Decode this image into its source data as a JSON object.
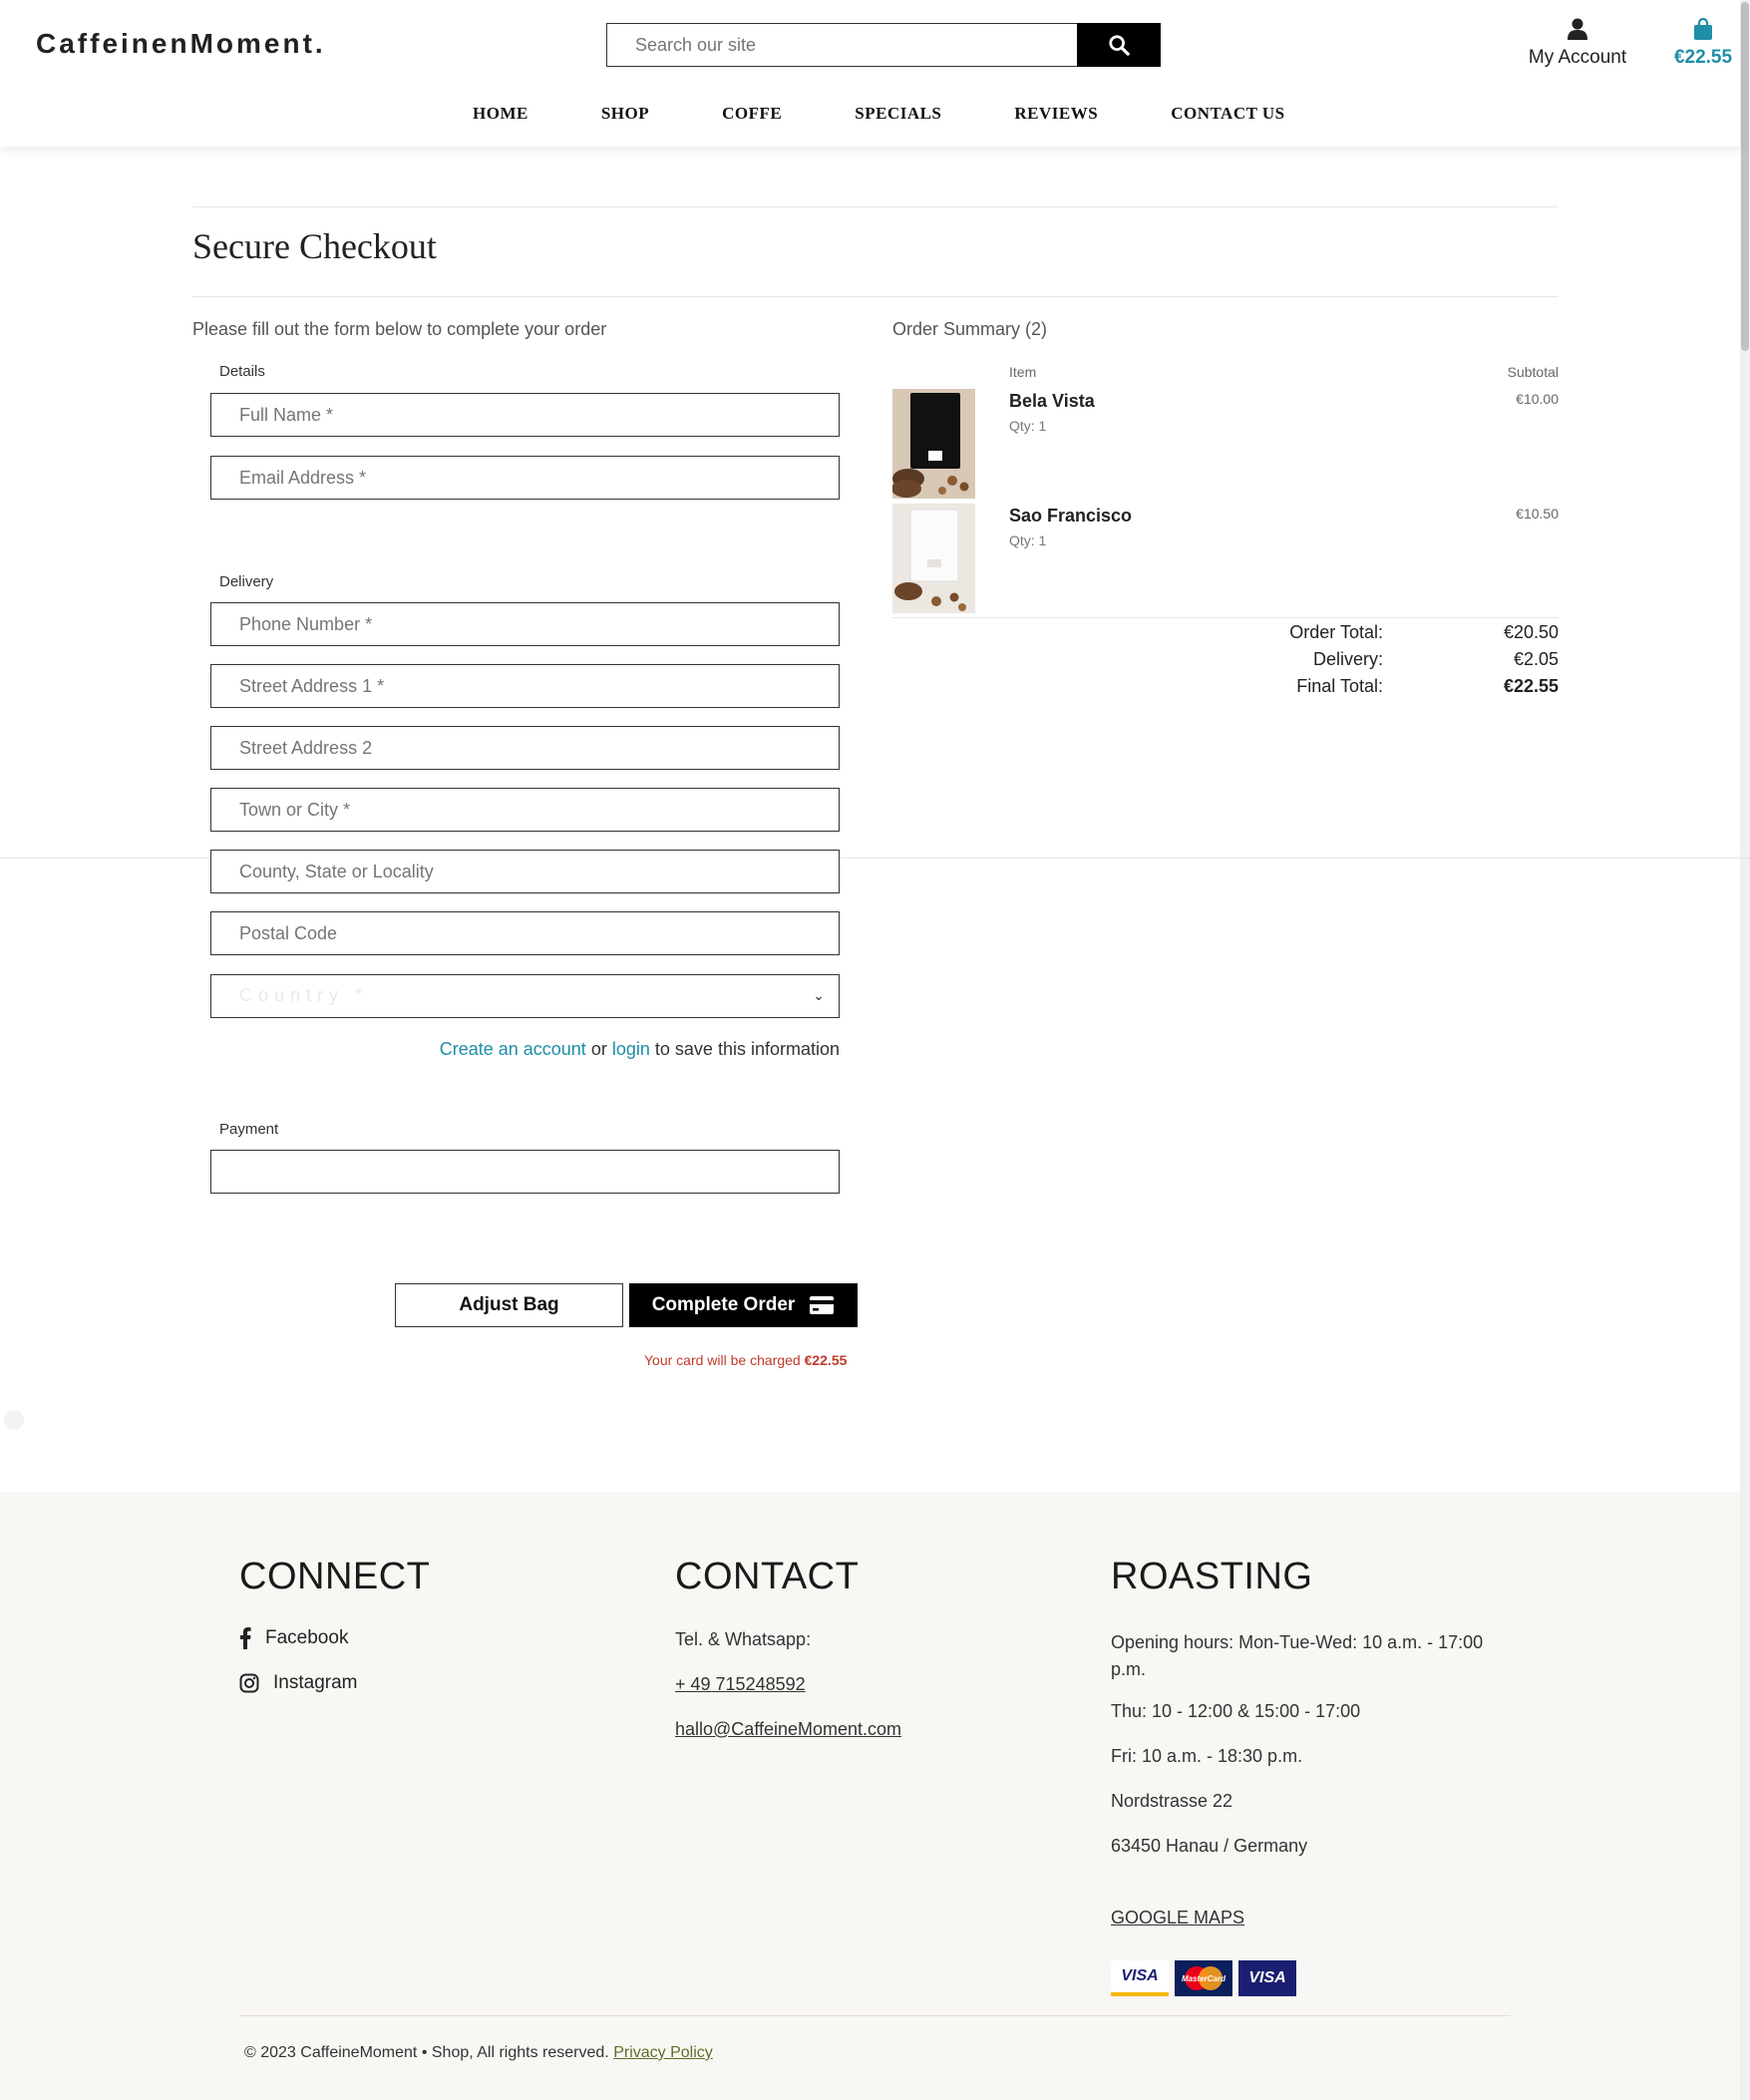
{
  "header": {
    "logo": "CaffeinenMoment.",
    "search_placeholder": "Search our site",
    "account_label": "My Account",
    "bag_total": "€22.55",
    "nav": [
      "HOME",
      "SHOP",
      "COFFE",
      "SPECIALS",
      "REVIEWS",
      "CONTACT US"
    ]
  },
  "checkout": {
    "title": "Secure Checkout",
    "intro": "Please fill out the form below to complete your order",
    "details_label": "Details",
    "full_name_placeholder": "Full Name *",
    "email_placeholder": "Email Address *",
    "delivery_label": "Delivery",
    "phone_placeholder": "Phone Number *",
    "street1_placeholder": "Street Address 1 *",
    "street2_placeholder": "Street Address 2",
    "town_placeholder": "Town or City *",
    "county_placeholder": "County, State or Locality",
    "postal_placeholder": "Postal Code",
    "country_selected": "Country *",
    "create_account": "Create an account",
    "or": "or",
    "login": "login",
    "save_suffix": "to save this information",
    "payment_label": "Payment",
    "adjust_bag": "Adjust Bag",
    "complete_order": "Complete Order",
    "charge_prefix": "Your card will be charged",
    "charge_amount": "€22.55"
  },
  "summary": {
    "title": "Order Summary (2)",
    "item_header": "Item",
    "subtotal_header": "Subtotal",
    "items": [
      {
        "name": "Bela Vista",
        "qty": "Qty: 1",
        "subtotal": "€10.00"
      },
      {
        "name": "Sao Francisco",
        "qty": "Qty: 1",
        "subtotal": "€10.50"
      }
    ],
    "order_total_label": "Order Total:",
    "order_total": "€20.50",
    "delivery_label": "Delivery:",
    "delivery": "€2.05",
    "final_total_label": "Final Total:",
    "final_total": "€22.55"
  },
  "footer": {
    "connect_heading": "CONNECT",
    "facebook": "Facebook",
    "instagram": "Instagram",
    "contact_heading": "CONTACT",
    "tel_label": "Tel. & Whatsapp:",
    "phone": "+ 49 715248592",
    "email": "hallo@CaffeineMoment.com",
    "roasting_heading": "ROASTING",
    "hours_1": "Opening hours: Mon-Tue-Wed: 10 a.m. - 17:00 p.m.",
    "hours_2": "Thu: 10 - 12:00 & 15:00 - 17:00",
    "hours_3": "Fri: 10 a.m. - 18:30 p.m.",
    "street": "Nordstrasse 22",
    "city": "63450 Hanau / Germany",
    "maps_link": "GOOGLE MAPS",
    "card_visa": "VISA",
    "card_mastercard": "MasterCard",
    "copyright": "© 2023 CaffeineMoment • Shop, All rights reserved.",
    "privacy": "Privacy Policy"
  },
  "colors": {
    "accent": "#1f8ea8",
    "charge_note": "#c0392b",
    "footer_bg": "#f9f7f4",
    "button_dark": "#000000"
  },
  "icons": [
    "search-icon",
    "user-icon",
    "shopping-bag-icon",
    "credit-card-icon",
    "chevron-down-icon",
    "facebook-icon",
    "instagram-icon",
    "visa-card-icon",
    "mastercard-icon"
  ]
}
